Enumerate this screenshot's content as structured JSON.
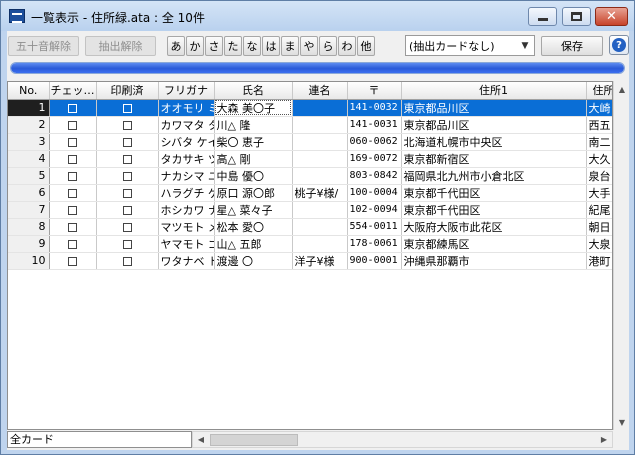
{
  "window": {
    "title": "一覧表示 - 住所緑.ata : 全 10件"
  },
  "toolbar": {
    "gojuon_clear": "五十音解除",
    "extract_clear": "抽出解除",
    "kana": [
      "あ",
      "か",
      "さ",
      "た",
      "な",
      "は",
      "ま",
      "や",
      "ら",
      "わ",
      "他"
    ],
    "filter_value": "(抽出カードなし)",
    "save_label": "保存",
    "help_label": "?"
  },
  "progress": {
    "percent": 100
  },
  "columns": [
    "No.",
    "チェッ…",
    "印刷済",
    "フリガナ",
    "氏名",
    "連名",
    "〒",
    "住所1",
    "住所2"
  ],
  "rows": [
    {
      "no": "1",
      "furigana": "オオモリ ミ",
      "name": "大森 美〇子",
      "renmei": "",
      "zip": "141-0032",
      "addr1": "東京都品川区",
      "addr2": "大崎"
    },
    {
      "no": "2",
      "furigana": "カワマタ タ",
      "name": "川△ 隆",
      "renmei": "",
      "zip": "141-0031",
      "addr1": "東京都品川区",
      "addr2": "西五"
    },
    {
      "no": "3",
      "furigana": "シバタ ケイ",
      "name": "柴〇 恵子",
      "renmei": "",
      "zip": "060-0062",
      "addr1": "北海道札幌市中央区",
      "addr2": "南二"
    },
    {
      "no": "4",
      "furigana": "タカサキ ツ",
      "name": "高△ 剛",
      "renmei": "",
      "zip": "169-0072",
      "addr1": "東京都新宿区",
      "addr2": "大久"
    },
    {
      "no": "5",
      "furigana": "ナカシマ ユ",
      "name": "中島 優〇",
      "renmei": "",
      "zip": "803-0842",
      "addr1": "福岡県北九州市小倉北区",
      "addr2": "泉台"
    },
    {
      "no": "6",
      "furigana": "ハラグチ ゲ",
      "name": "原口 源〇郎",
      "renmei": "桃子¥様/",
      "zip": "100-0004",
      "addr1": "東京都千代田区",
      "addr2": "大手"
    },
    {
      "no": "7",
      "furigana": "ホシカワ ナ",
      "name": "星△ 菜々子",
      "renmei": "",
      "zip": "102-0094",
      "addr1": "東京都千代田区",
      "addr2": "紀尾"
    },
    {
      "no": "8",
      "furigana": "マツモト メ",
      "name": "松本 愛〇",
      "renmei": "",
      "zip": "554-0011",
      "addr1": "大阪府大阪市此花区",
      "addr2": "朝日"
    },
    {
      "no": "9",
      "furigana": "ヤマモト ゴ",
      "name": "山△ 五郎",
      "renmei": "",
      "zip": "178-0061",
      "addr1": "東京都練馬区",
      "addr2": "大泉"
    },
    {
      "no": "10",
      "furigana": "ワタナベ ト",
      "name": "渡邊 〇",
      "renmei": "洋子¥様",
      "zip": "900-0001",
      "addr1": "沖縄県那覇市",
      "addr2": "港町"
    }
  ],
  "selected_row": 0,
  "status": {
    "card_filter": "全カード"
  },
  "colors": {
    "selection": "#0a6ed6",
    "progress": "#2a5ad8",
    "titlebar": "#bfd4ee"
  },
  "icons": {
    "app": "app-list-icon",
    "help": "help-icon"
  }
}
